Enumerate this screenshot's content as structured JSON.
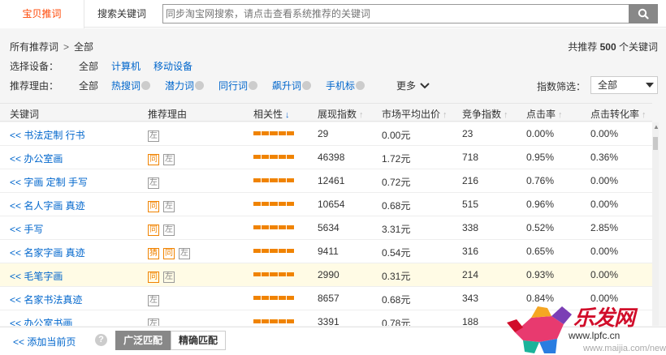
{
  "tabs": [
    {
      "label": "宝贝推词",
      "active": true
    },
    {
      "label": "搜索关键词",
      "active": false
    }
  ],
  "search": {
    "placeholder": "同步淘宝网搜索，请点击查看系统推荐的关键词"
  },
  "breadcrumb": {
    "root": "所有推荐词",
    "separator": ">",
    "current": "全部"
  },
  "total": {
    "prefix": "共推荐",
    "count": "500",
    "suffix": "个关键词"
  },
  "device_filter": {
    "label": "选择设备：",
    "options": [
      "全部",
      "计算机",
      "移动设备"
    ]
  },
  "reason_filter": {
    "label": "推荐理由：",
    "options": [
      "全部",
      "热搜词",
      "潜力词",
      "同行词",
      "飙升词",
      "手机标"
    ],
    "more": "更多"
  },
  "index_filter": {
    "label": "指数筛选：",
    "value": "全部"
  },
  "columns": [
    "关键词",
    "推荐理由",
    "相关性",
    "展现指数",
    "市场平均出价",
    "竞争指数",
    "点击率",
    "点击转化率"
  ],
  "rows": [
    {
      "keyword": "书法定制 行书",
      "tags": [
        "左"
      ],
      "impressions": "29",
      "avg_bid": "0.00元",
      "competition": "23",
      "ctr": "0.00%",
      "cvr": "0.00%"
    },
    {
      "keyword": "办公室画",
      "tags": [
        "同",
        "左"
      ],
      "impressions": "46398",
      "avg_bid": "1.72元",
      "competition": "718",
      "ctr": "0.95%",
      "cvr": "0.36%"
    },
    {
      "keyword": "字画 定制 手写",
      "tags": [
        "左"
      ],
      "impressions": "12461",
      "avg_bid": "0.72元",
      "competition": "216",
      "ctr": "0.76%",
      "cvr": "0.00%"
    },
    {
      "keyword": "名人字画 真迹",
      "tags": [
        "同",
        "左"
      ],
      "impressions": "10654",
      "avg_bid": "0.68元",
      "competition": "515",
      "ctr": "0.96%",
      "cvr": "0.00%"
    },
    {
      "keyword": "手写",
      "tags": [
        "同",
        "左"
      ],
      "impressions": "5634",
      "avg_bid": "3.31元",
      "competition": "338",
      "ctr": "0.52%",
      "cvr": "2.85%"
    },
    {
      "keyword": "名家字画 真迹",
      "tags": [
        "猜",
        "同",
        "左"
      ],
      "impressions": "9411",
      "avg_bid": "0.54元",
      "competition": "316",
      "ctr": "0.65%",
      "cvr": "0.00%"
    },
    {
      "keyword": "毛笔字画",
      "tags": [
        "同",
        "左"
      ],
      "impressions": "2990",
      "avg_bid": "0.31元",
      "competition": "214",
      "ctr": "0.93%",
      "cvr": "0.00%"
    },
    {
      "keyword": "名家书法真迹",
      "tags": [
        "左"
      ],
      "impressions": "8657",
      "avg_bid": "0.68元",
      "competition": "343",
      "ctr": "0.84%",
      "cvr": "0.00%"
    },
    {
      "keyword": "办公室书画",
      "tags": [
        "左"
      ],
      "impressions": "3391",
      "avg_bid": "0.78元",
      "competition": "188",
      "ctr": "",
      "cvr": ""
    }
  ],
  "row_prefix": "<<",
  "footer": {
    "add_page": "<<  添加当前页",
    "help": "?",
    "broad_match": "广泛匹配",
    "exact_match": "精确匹配"
  },
  "watermark": {
    "text": "乐发网",
    "url": "www.lpfc.cn",
    "url2": "www.maijia.com/news"
  },
  "colors": {
    "accent": "#ff4400",
    "link": "#0066cc",
    "tag_orange": "#f08300",
    "highlight_row": "#fffbe5"
  }
}
